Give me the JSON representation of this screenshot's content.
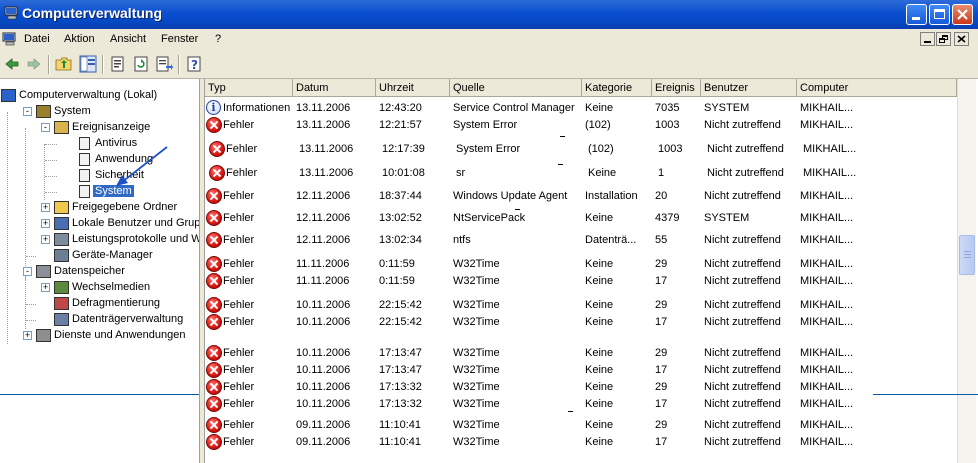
{
  "window": {
    "title": "Computerverwaltung"
  },
  "menu": [
    "Datei",
    "Aktion",
    "Ansicht",
    "Fenster",
    "?"
  ],
  "tree": [
    {
      "label": "Computerverwaltung (Lokal)",
      "icon": "computer-management-icon",
      "level": 0,
      "expander": ""
    },
    {
      "label": "System",
      "icon": "system-tools-icon",
      "level": 1,
      "expander": "-"
    },
    {
      "label": "Ereignisanzeige",
      "icon": "event-viewer-icon",
      "level": 2,
      "expander": "-"
    },
    {
      "label": "Antivirus",
      "icon": "event-log-icon",
      "level": 3,
      "expander": ""
    },
    {
      "label": "Anwendung",
      "icon": "event-log-icon",
      "level": 3,
      "expander": ""
    },
    {
      "label": "Sicherheit",
      "icon": "event-log-icon",
      "level": 3,
      "expander": ""
    },
    {
      "label": "System",
      "icon": "event-log-icon",
      "level": 3,
      "expander": "",
      "selected": true
    },
    {
      "label": "Freigegebene Ordner",
      "icon": "shared-folder-icon",
      "level": 2,
      "expander": "+"
    },
    {
      "label": "Lokale Benutzer und Gruppen",
      "icon": "users-icon",
      "level": 2,
      "expander": "+"
    },
    {
      "label": "Leistungsprotokolle und Warnungen",
      "icon": "performance-icon",
      "level": 2,
      "expander": "+"
    },
    {
      "label": "Geräte-Manager",
      "icon": "device-manager-icon",
      "level": 2,
      "expander": ""
    },
    {
      "label": "Datenspeicher",
      "icon": "storage-icon",
      "level": 1,
      "expander": "-"
    },
    {
      "label": "Wechselmedien",
      "icon": "removable-media-icon",
      "level": 2,
      "expander": "+"
    },
    {
      "label": "Defragmentierung",
      "icon": "defrag-icon",
      "level": 2,
      "expander": ""
    },
    {
      "label": "Datenträgerverwaltung",
      "icon": "disk-management-icon",
      "level": 2,
      "expander": ""
    },
    {
      "label": "Dienste und Anwendungen",
      "icon": "services-icon",
      "level": 1,
      "expander": "+"
    }
  ],
  "columns": [
    "Typ",
    "Datum",
    "Uhrzeit",
    "Quelle",
    "Kategorie",
    "Ereignis",
    "Benutzer",
    "Computer"
  ],
  "events": [
    {
      "type": "info",
      "typ": "Informationen",
      "datum": "13.11.2006",
      "uhrzeit": "12:43:20",
      "quelle": "Service Control Manager",
      "kategorie": "Keine",
      "ereignis": "7035",
      "benutzer": "SYSTEM",
      "computer": "MIKHAIL..."
    },
    {
      "type": "error",
      "typ": "Fehler",
      "datum": "13.11.2006",
      "uhrzeit": "12:21:57",
      "quelle": "System Error",
      "kategorie": "(102)",
      "ereignis": "1003",
      "benutzer": "Nicht zutreffend",
      "computer": "MIKHAIL..."
    },
    {
      "type": "error",
      "typ": "Fehler",
      "datum": "13.11.2006",
      "uhrzeit": "12:17:39",
      "quelle": "System Error",
      "kategorie": "(102)",
      "ereignis": "1003",
      "benutzer": "Nicht zutreffend",
      "computer": "MIKHAIL..."
    },
    {
      "type": "error",
      "typ": "Fehler",
      "datum": "13.11.2006",
      "uhrzeit": "10:01:08",
      "quelle": "sr",
      "kategorie": "Keine",
      "ereignis": "1",
      "benutzer": "Nicht zutreffend",
      "computer": "MIKHAIL..."
    },
    {
      "type": "error",
      "typ": "Fehler",
      "datum": "12.11.2006",
      "uhrzeit": "18:37:44",
      "quelle": "Windows Update Agent",
      "kategorie": "Installation",
      "ereignis": "20",
      "benutzer": "Nicht zutreffend",
      "computer": "MIKHAIL..."
    },
    {
      "type": "error",
      "typ": "Fehler",
      "datum": "12.11.2006",
      "uhrzeit": "13:02:52",
      "quelle": "NtServicePack",
      "kategorie": "Keine",
      "ereignis": "4379",
      "benutzer": "SYSTEM",
      "computer": "MIKHAIL..."
    },
    {
      "type": "error",
      "typ": "Fehler",
      "datum": "12.11.2006",
      "uhrzeit": "13:02:34",
      "quelle": "ntfs",
      "kategorie": "Datenträ...",
      "ereignis": "55",
      "benutzer": "Nicht zutreffend",
      "computer": "MIKHAIL..."
    },
    {
      "type": "error",
      "typ": "Fehler",
      "datum": "11.11.2006",
      "uhrzeit": "0:11:59",
      "quelle": "W32Time",
      "kategorie": "Keine",
      "ereignis": "29",
      "benutzer": "Nicht zutreffend",
      "computer": "MIKHAIL..."
    },
    {
      "type": "error",
      "typ": "Fehler",
      "datum": "11.11.2006",
      "uhrzeit": "0:11:59",
      "quelle": "W32Time",
      "kategorie": "Keine",
      "ereignis": "17",
      "benutzer": "Nicht zutreffend",
      "computer": "MIKHAIL..."
    },
    {
      "type": "error",
      "typ": "Fehler",
      "datum": "10.11.2006",
      "uhrzeit": "22:15:42",
      "quelle": "W32Time",
      "kategorie": "Keine",
      "ereignis": "29",
      "benutzer": "Nicht zutreffend",
      "computer": "MIKHAIL..."
    },
    {
      "type": "error",
      "typ": "Fehler",
      "datum": "10.11.2006",
      "uhrzeit": "22:15:42",
      "quelle": "W32Time",
      "kategorie": "Keine",
      "ereignis": "17",
      "benutzer": "Nicht zutreffend",
      "computer": "MIKHAIL..."
    },
    {
      "type": "error",
      "typ": "Fehler",
      "datum": "10.11.2006",
      "uhrzeit": "17:13:47",
      "quelle": "W32Time",
      "kategorie": "Keine",
      "ereignis": "29",
      "benutzer": "Nicht zutreffend",
      "computer": "MIKHAIL..."
    },
    {
      "type": "error",
      "typ": "Fehler",
      "datum": "10.11.2006",
      "uhrzeit": "17:13:47",
      "quelle": "W32Time",
      "kategorie": "Keine",
      "ereignis": "17",
      "benutzer": "Nicht zutreffend",
      "computer": "MIKHAIL..."
    },
    {
      "type": "error",
      "typ": "Fehler",
      "datum": "10.11.2006",
      "uhrzeit": "17:13:32",
      "quelle": "W32Time",
      "kategorie": "Keine",
      "ereignis": "29",
      "benutzer": "Nicht zutreffend",
      "computer": "MIKHAIL..."
    },
    {
      "type": "error",
      "typ": "Fehler",
      "datum": "10.11.2006",
      "uhrzeit": "17:13:32",
      "quelle": "W32Time",
      "kategorie": "Keine",
      "ereignis": "17",
      "benutzer": "Nicht zutreffend",
      "computer": "MIKHAIL..."
    },
    {
      "type": "error",
      "typ": "Fehler",
      "datum": "09.11.2006",
      "uhrzeit": "11:10:41",
      "quelle": "W32Time",
      "kategorie": "Keine",
      "ereignis": "29",
      "benutzer": "Nicht zutreffend",
      "computer": "MIKHAIL..."
    },
    {
      "type": "error",
      "typ": "Fehler",
      "datum": "09.11.2006",
      "uhrzeit": "11:10:41",
      "quelle": "W32Time",
      "kategorie": "Keine",
      "ereignis": "17",
      "benutzer": "Nicht zutreffend",
      "computer": "MIKHAIL..."
    }
  ],
  "colors": {
    "title_bar": "#0a4fd0",
    "selection": "#316ac5",
    "error": "#d8140e",
    "annotation": "#0b5aa8"
  }
}
